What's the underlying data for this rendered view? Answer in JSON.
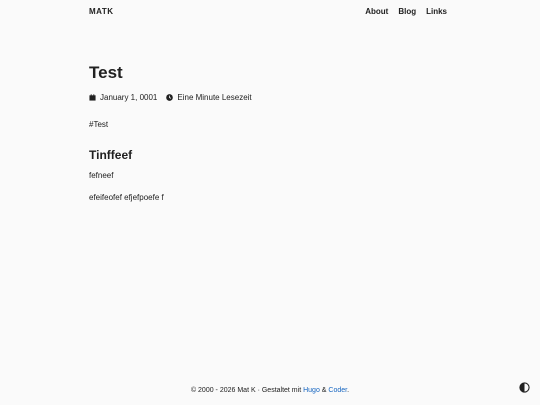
{
  "nav": {
    "brand": "MATK",
    "items": [
      {
        "label": "About"
      },
      {
        "label": "Blog"
      },
      {
        "label": "Links"
      }
    ]
  },
  "post": {
    "title": "Test",
    "date": "January 1, 0001",
    "reading_time": "Eine Minute Lesezeit",
    "tagline": "#Test",
    "heading": "Tinffeef",
    "paragraphs": [
      "fefneef",
      "efeifeofef efjefpoefe f"
    ]
  },
  "footer": {
    "prefix": "© 2000 - 2026 Mat K · Gestaltet mit",
    "hugo": "Hugo",
    "amp": "&",
    "coder": "Coder",
    "period": "."
  },
  "icons": {
    "date": "calendar-icon",
    "reading_time": "clock-icon",
    "theme": "contrast-icon"
  },
  "colors": {
    "background": "#fafafa",
    "text": "#212121",
    "link": "#1565c0"
  }
}
